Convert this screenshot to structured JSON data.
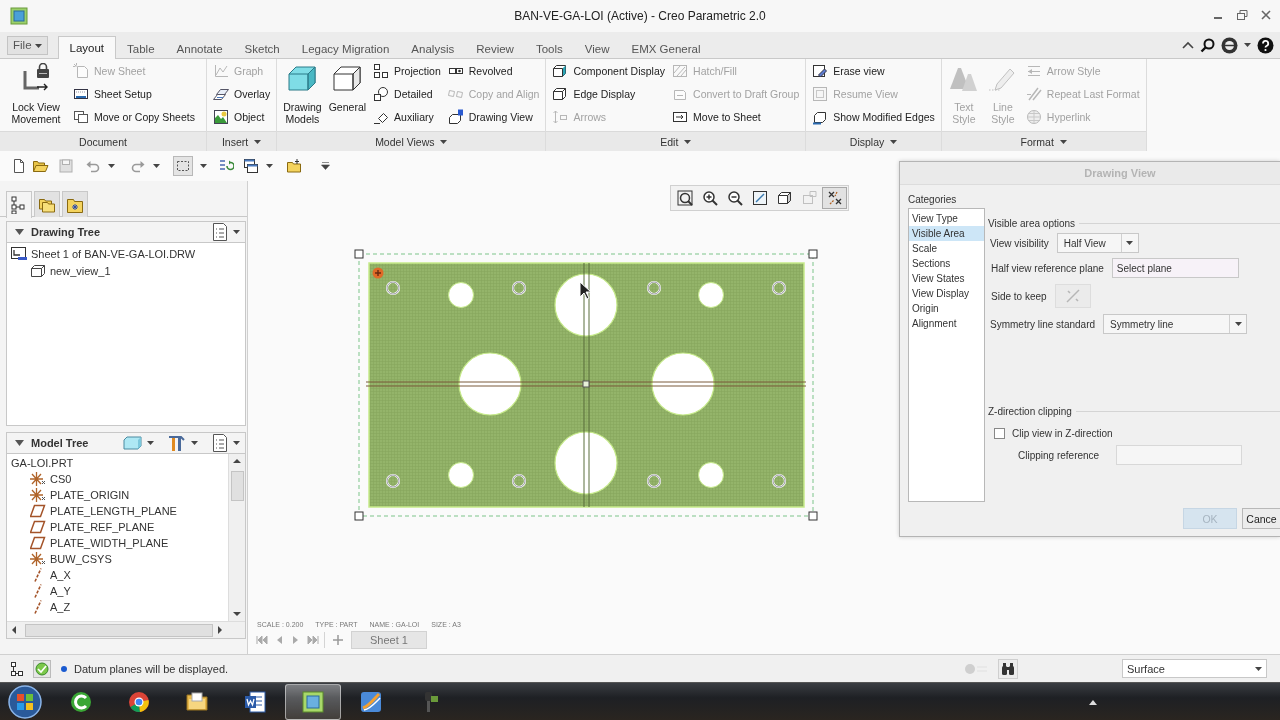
{
  "window": {
    "title": "BAN-VE-GA-LOI (Active) - Creo Parametric 2.0"
  },
  "ribbon_tabs": [
    {
      "label": "File",
      "kind": "menu",
      "selected": false
    },
    {
      "label": "Layout",
      "kind": "tab",
      "selected": true
    },
    {
      "label": "Table",
      "kind": "tab",
      "selected": false
    },
    {
      "label": "Annotate",
      "kind": "tab",
      "selected": false
    },
    {
      "label": "Sketch",
      "kind": "tab",
      "selected": false
    },
    {
      "label": "Legacy Migration",
      "kind": "tab",
      "selected": false
    },
    {
      "label": "Analysis",
      "kind": "tab",
      "selected": false
    },
    {
      "label": "Review",
      "kind": "tab",
      "selected": false
    },
    {
      "label": "Tools",
      "kind": "tab",
      "selected": false
    },
    {
      "label": "View",
      "kind": "tab",
      "selected": false
    },
    {
      "label": "EMX General",
      "kind": "tab",
      "selected": false
    }
  ],
  "ribbon_groups": [
    {
      "label": "Document",
      "dropdown": false,
      "items": [
        {
          "label": "Lock View Movement",
          "kind": "large",
          "disabled": false
        },
        {
          "label": "New Sheet",
          "kind": "small",
          "disabled": true
        },
        {
          "label": "Sheet Setup",
          "kind": "small",
          "disabled": false
        },
        {
          "label": "Move or Copy Sheets",
          "kind": "small",
          "disabled": false
        }
      ]
    },
    {
      "label": "Insert",
      "dropdown": true,
      "items": [
        {
          "label": "Graph",
          "kind": "small",
          "disabled": true
        },
        {
          "label": "Overlay",
          "kind": "small",
          "disabled": false
        },
        {
          "label": "Object",
          "kind": "small",
          "disabled": false
        }
      ]
    },
    {
      "label": "Model Views",
      "dropdown": true,
      "items": [
        {
          "label": "Drawing Models",
          "kind": "large",
          "disabled": false
        },
        {
          "label": "General",
          "kind": "large",
          "disabled": false
        },
        {
          "label": "Projection",
          "kind": "small",
          "disabled": false
        },
        {
          "label": "Detailed",
          "kind": "small",
          "disabled": false
        },
        {
          "label": "Auxiliary",
          "kind": "small",
          "disabled": false
        },
        {
          "label": "Revolved",
          "kind": "small",
          "disabled": false
        },
        {
          "label": "Copy and Align",
          "kind": "small",
          "disabled": true
        },
        {
          "label": "Drawing View",
          "kind": "small",
          "disabled": false
        }
      ]
    },
    {
      "label": "Edit",
      "dropdown": true,
      "items": [
        {
          "label": "Component Display",
          "kind": "small",
          "disabled": false
        },
        {
          "label": "Edge Display",
          "kind": "small",
          "disabled": false
        },
        {
          "label": "Arrows",
          "kind": "small",
          "disabled": true
        },
        {
          "label": "Hatch/Fill",
          "kind": "small",
          "disabled": true
        },
        {
          "label": "Convert to Draft Group",
          "kind": "small",
          "disabled": true
        },
        {
          "label": "Move to Sheet",
          "kind": "small",
          "disabled": false
        }
      ]
    },
    {
      "label": "Display",
      "dropdown": true,
      "items": [
        {
          "label": "Erase view",
          "kind": "small",
          "disabled": false
        },
        {
          "label": "Resume View",
          "kind": "small",
          "disabled": true
        },
        {
          "label": "Show Modified Edges",
          "kind": "small",
          "disabled": false
        }
      ]
    },
    {
      "label": "Format",
      "dropdown": true,
      "items": [
        {
          "label": "Text Style",
          "kind": "large",
          "disabled": true
        },
        {
          "label": "Line Style",
          "kind": "large",
          "disabled": true
        },
        {
          "label": "Arrow Style",
          "kind": "small",
          "disabled": true
        },
        {
          "label": "Repeat Last Format",
          "kind": "small",
          "disabled": true
        },
        {
          "label": "Hyperlink",
          "kind": "small",
          "disabled": true
        }
      ]
    }
  ],
  "panel_tabs": [
    {
      "selected": true
    },
    {
      "selected": false
    },
    {
      "selected": false
    }
  ],
  "drawing_tree": {
    "title": "Drawing Tree",
    "expanded": true,
    "items": [
      {
        "label": "Sheet 1 of BAN-VE-GA-LOI.DRW",
        "kind": "sheet",
        "children": [
          {
            "label": "new_view_1",
            "kind": "view"
          }
        ]
      }
    ]
  },
  "model_tree": {
    "title": "Model Tree",
    "expanded": true,
    "items": [
      {
        "label": "GA-LOI.PRT",
        "children": [
          {
            "label": "CS0",
            "kind": "csys"
          },
          {
            "label": "PLATE_ORIGIN",
            "kind": "csys"
          },
          {
            "label": "PLATE_LENGTH_PLANE",
            "kind": "plane"
          },
          {
            "label": "PLATE_REF_PLANE",
            "kind": "plane"
          },
          {
            "label": "PLATE_WIDTH_PLANE",
            "kind": "plane"
          },
          {
            "label": "BUW_CSYS",
            "kind": "csys"
          },
          {
            "label": "A_X",
            "kind": "axis"
          },
          {
            "label": "A_Y",
            "kind": "axis"
          },
          {
            "label": "A_Z",
            "kind": "axis"
          }
        ]
      }
    ]
  },
  "view_toolbar": [
    {
      "pressed": false,
      "disabled": false
    },
    {
      "pressed": false,
      "disabled": false
    },
    {
      "pressed": false,
      "disabled": false
    },
    {
      "pressed": false,
      "disabled": false
    },
    {
      "pressed": false,
      "disabled": false
    },
    {
      "pressed": false,
      "disabled": true
    },
    {
      "pressed": true,
      "disabled": false
    }
  ],
  "sheet_info": [
    "SCALE : 0.200",
    "TYPE : PART",
    "NAME : GA-LOI",
    "SIZE : A3"
  ],
  "sheet_tabs": [
    {
      "label": "Sheet 1",
      "selected": true
    }
  ],
  "dialog": {
    "title": "Drawing View",
    "active": false,
    "categories_label": "Categories",
    "categories": [
      {
        "label": "View Type",
        "selected": false
      },
      {
        "label": "Visible Area",
        "selected": true
      },
      {
        "label": "Scale",
        "selected": false
      },
      {
        "label": "Sections",
        "selected": false
      },
      {
        "label": "View States",
        "selected": false
      },
      {
        "label": "View Display",
        "selected": false
      },
      {
        "label": "Origin",
        "selected": false
      },
      {
        "label": "Alignment",
        "selected": false
      }
    ],
    "visible_area": {
      "heading": "Visible area options",
      "view_visibility": {
        "label": "View visibility",
        "value": "Half View"
      },
      "reference_plane": {
        "label": "Half view reference plane",
        "value": "Select plane"
      },
      "side_to_keep": {
        "label": "Side to keep",
        "disabled": true
      },
      "symmetry_line": {
        "label": "Symmetry line standard",
        "value": "Symmetry line"
      }
    },
    "z_clipping": {
      "heading": "Z-direction clipping",
      "clip": {
        "label": "Clip view in Z-direction",
        "checked": false
      },
      "reference": {
        "label": "Clipping reference",
        "disabled": true
      }
    },
    "buttons": [
      {
        "label": "OK",
        "disabled": true
      },
      {
        "label": "Cance",
        "disabled": false
      }
    ]
  },
  "status_bar": {
    "message": "Datum planes will be displayed.",
    "filter": "Surface"
  },
  "taskbar_apps": [
    {
      "active": false
    },
    {
      "active": false
    },
    {
      "active": false
    },
    {
      "active": false
    },
    {
      "active": true
    },
    {
      "active": false
    },
    {
      "active": false
    }
  ]
}
